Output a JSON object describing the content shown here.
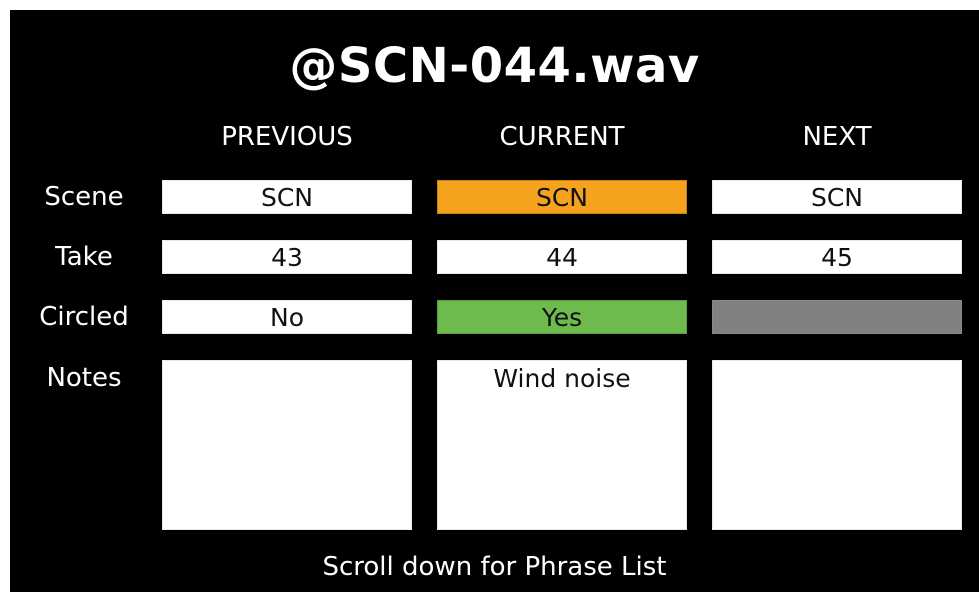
{
  "title": "@SCN-044.wav",
  "columns": {
    "previous": "PREVIOUS",
    "current": "CURRENT",
    "next": "NEXT"
  },
  "rows": {
    "scene": "Scene",
    "take": "Take",
    "circled": "Circled",
    "notes": "Notes"
  },
  "previous": {
    "scene": "SCN",
    "take": "43",
    "circled": "No",
    "notes": ""
  },
  "current": {
    "scene": "SCN",
    "take": "44",
    "circled": "Yes",
    "notes": "Wind noise"
  },
  "next": {
    "scene": "SCN",
    "take": "45",
    "circled": "",
    "notes": ""
  },
  "footer": "Scroll down for Phrase List",
  "colors": {
    "background": "#000000",
    "current_scene": "#f5a31f",
    "circled_yes": "#6cbb4c",
    "circled_unknown": "#808080"
  }
}
